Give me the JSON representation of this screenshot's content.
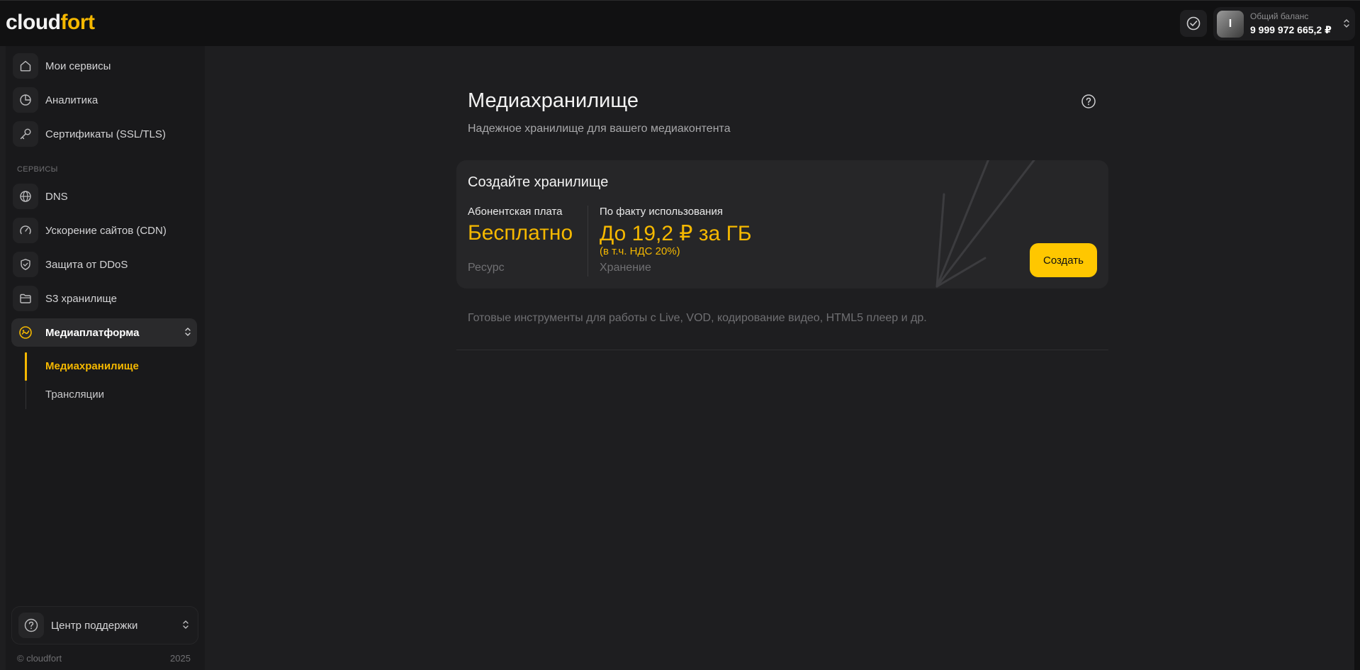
{
  "header": {
    "logo_part1": "cloud",
    "logo_part2": "fort",
    "balance_label": "Общий баланс",
    "balance_value": "9 999 972 665,2 ₽",
    "avatar_letter": "I"
  },
  "sidebar": {
    "items": [
      {
        "label": "Мои сервисы",
        "icon": "home-icon"
      },
      {
        "label": "Аналитика",
        "icon": "pie-chart-icon"
      },
      {
        "label": "Сертификаты (SSL/TLS)",
        "icon": "key-icon"
      },
      {
        "label": "DNS",
        "icon": "globe-icon"
      },
      {
        "label": "Ускорение сайтов (CDN)",
        "icon": "speedometer-icon"
      },
      {
        "label": "Защита от DDoS",
        "icon": "shield-icon"
      },
      {
        "label": "S3 хранилище",
        "icon": "folder-icon"
      },
      {
        "label": "Медиаплатформа",
        "icon": "media-icon"
      }
    ],
    "section_label": "СЕРВИСЫ",
    "sub_items": [
      {
        "label": "Медиахранилище"
      },
      {
        "label": "Трансляции"
      }
    ],
    "support_label": "Центр поддержки",
    "copyright": "© cloudfort",
    "year": "2025"
  },
  "main": {
    "title": "Медиахранилище",
    "subtitle": "Надежное хранилище для вашего медиаконтента",
    "card": {
      "title": "Создайте хранилище",
      "col1_label": "Абонентская плата",
      "col1_price": "Бесплатно",
      "col1_meta": "Ресурс",
      "col2_label": "По факту использования",
      "col2_price": "До 19,2 ₽ за ГБ",
      "col2_note": "(в т.ч. НДС 20%)",
      "col2_meta": "Хранение",
      "button_label": "Создать"
    },
    "tools_text": "Готовые инструменты для работы с Live, VOD, кодирование видео, HTML5 плеер и др."
  },
  "colors": {
    "accent": "#f5b800",
    "button": "#ffc700",
    "background": "#1e1e20",
    "sidebar": "#19191b"
  }
}
